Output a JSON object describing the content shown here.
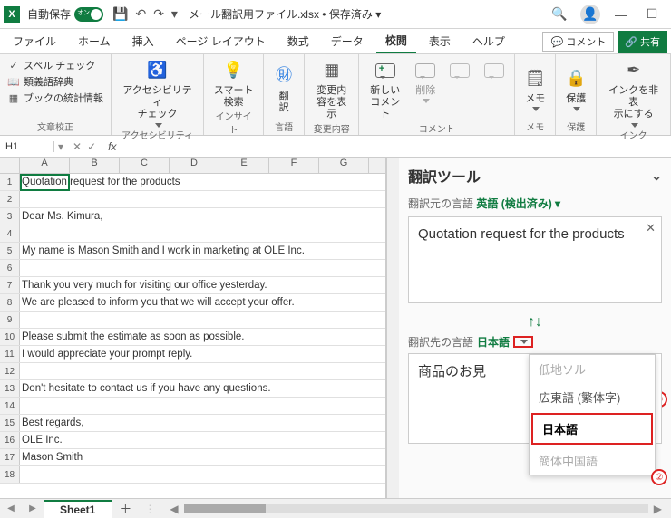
{
  "titlebar": {
    "autosave_label": "自動保存",
    "autosave_toggle": "オン",
    "filename": "メール翻訳用ファイル.xlsx",
    "saved_status": "保存済み"
  },
  "tabs": {
    "file": "ファイル",
    "home": "ホーム",
    "insert": "挿入",
    "pagelayout": "ページ レイアウト",
    "formulas": "数式",
    "data": "データ",
    "review": "校閲",
    "view": "表示",
    "help": "ヘルプ",
    "comment_btn": "コメント",
    "share_btn": "共有"
  },
  "ribbon": {
    "spellcheck": "スペル チェック",
    "thesaurus": "類義語辞典",
    "stats": "ブックの統計情報",
    "group_proofing": "文章校正",
    "accessibility": "アクセシビリティ\nチェック",
    "group_accessibility": "アクセシビリティ",
    "smartlookup": "スマート\n検索",
    "group_insights": "インサイト",
    "translate": "翻\n訳",
    "group_language": "言語",
    "showchanges": "変更内\n容を表示",
    "group_changes": "変更内容",
    "newcomment": "新しい\nコメント",
    "delete": "削除",
    "group_comments": "コメント",
    "memo": "メモ",
    "group_memo": "メモ",
    "protect": "保護",
    "group_protect": "保護",
    "hideink": "インクを非表\n示にする",
    "group_ink": "インク"
  },
  "formula": {
    "cellref": "H1",
    "fx": "fx"
  },
  "columns": [
    "A",
    "B",
    "C",
    "D",
    "E",
    "F",
    "G"
  ],
  "cells": [
    "Quotation request for the products",
    "",
    "Dear Ms. Kimura,",
    "",
    "My name is Mason Smith and I work in marketing at OLE Inc.",
    "",
    "Thank you very much for visiting our office yesterday.",
    "We are pleased to inform you that we will accept your offer.",
    "",
    "Please submit the estimate as soon as possible.",
    "I would appreciate your prompt reply.",
    "",
    "Don't hesitate to contact us if you have any questions.",
    "",
    "Best regards,",
    "OLE Inc.",
    "Mason Smith",
    ""
  ],
  "sheettab": "Sheet1",
  "pane": {
    "title": "翻訳ツール",
    "from_label": "翻訳元の言語",
    "from_lang": "英語 (検出済み)",
    "source_text": "Quotation request for the products",
    "to_label": "翻訳先の言語",
    "to_lang": "日本語",
    "result_text": "商品のお見",
    "menu": {
      "opt1": "低地ソル",
      "opt2": "広東語 (繁体字)",
      "opt3": "日本語",
      "opt4": "簡体中国語"
    }
  },
  "annotations": {
    "c1": "①",
    "c2": "②"
  }
}
